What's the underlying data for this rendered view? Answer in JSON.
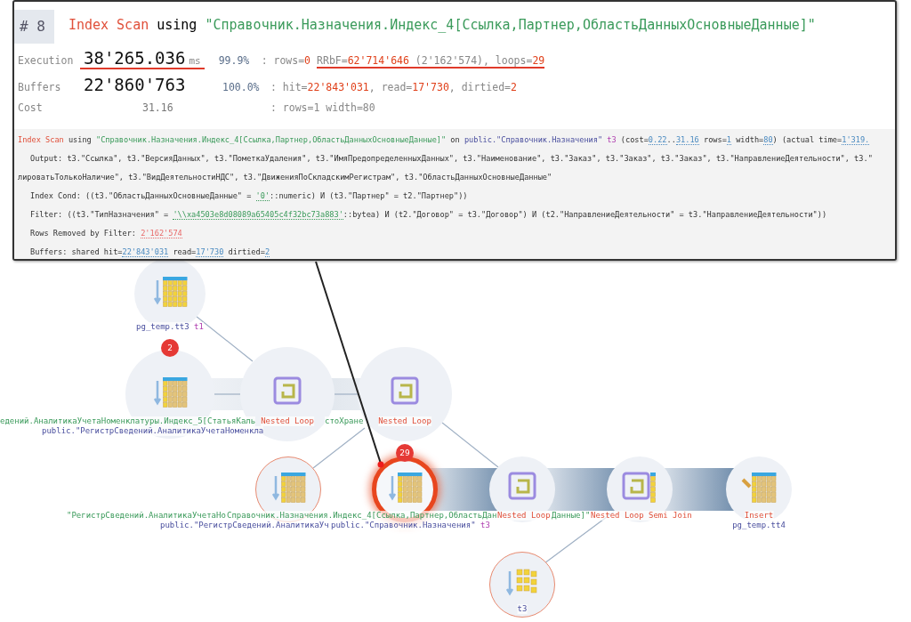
{
  "popup": {
    "node_number": "# 8",
    "title": [
      {
        "kind": "op",
        "text": "Index Scan"
      },
      {
        "kind": "plain",
        "text": " using "
      },
      {
        "kind": "name",
        "text": "\"Справочник.Назначения.Индекс_4[Ссылка,Партнер,ОбластьДанныхОсновныеДанные]\""
      }
    ],
    "metrics": [
      {
        "label": "Execution",
        "value": "38'265.036",
        "unit": "ms",
        "percent": "99.9%",
        "underlined": true,
        "details": [
          {
            "underlined": false,
            "segments": [
              {
                "kind": "plain",
                "text": ": rows="
              },
              {
                "kind": "count",
                "text": "0"
              }
            ]
          },
          {
            "underlined": true,
            "segments": [
              {
                "kind": "plain",
                "text": "RRbF="
              },
              {
                "kind": "count",
                "text": "62'714'646"
              },
              {
                "kind": "plain",
                "text": " (2'162'574), loops="
              },
              {
                "kind": "count",
                "text": "29"
              }
            ]
          }
        ]
      },
      {
        "label": "Buffers",
        "value": "22'860'763",
        "percent": "100.0%",
        "underlined": false,
        "details": [
          {
            "underlined": false,
            "segments": [
              {
                "kind": "plain",
                "text": ": hit="
              },
              {
                "kind": "count",
                "text": "22'843'031"
              },
              {
                "kind": "plain",
                "text": ", read="
              },
              {
                "kind": "count",
                "text": "17'730"
              },
              {
                "kind": "plain",
                "text": ", dirtied="
              },
              {
                "kind": "count",
                "text": "2"
              }
            ]
          }
        ]
      },
      {
        "label": "Cost",
        "value": "31.16",
        "underlined": false,
        "details": [
          {
            "underlined": false,
            "segments": [
              {
                "kind": "plain",
                "text": ": rows=1 width=80"
              }
            ]
          }
        ]
      }
    ],
    "detail_lines": [
      {
        "indent": false,
        "segments": [
          {
            "kind": "op",
            "text": "Index Scan"
          },
          {
            "kind": "plain",
            "text": " using "
          },
          {
            "kind": "name",
            "text": "\"Справочник.Назначения.Индекс_4[Ссылка,Партнер,ОбластьДанныхОсновныеДанные]\""
          },
          {
            "kind": "plain",
            "text": " on "
          },
          {
            "kind": "relation",
            "text": "public.\"Справочник.Назначения\""
          },
          {
            "kind": "alias",
            "text": "t3"
          },
          {
            "kind": "plain",
            "text": "  (cost="
          },
          {
            "kind": "number",
            "text": "0.22"
          },
          {
            "kind": "plain",
            "text": ".."
          },
          {
            "kind": "number",
            "text": "31.16"
          },
          {
            "kind": "plain",
            "text": " rows="
          },
          {
            "kind": "number",
            "text": "1"
          },
          {
            "kind": "plain",
            "text": " width="
          },
          {
            "kind": "number",
            "text": "80"
          },
          {
            "kind": "plain",
            "text": ") (actual time="
          },
          {
            "kind": "number",
            "text": "1'319."
          }
        ]
      },
      {
        "indent": true,
        "segments": [
          {
            "kind": "plain",
            "text": "Output: t3.\"Ссылка\", t3.\"ВерсияДанных\", t3.\"ПометкаУдаления\", t3.\"ИмяПредопределенныхДанных\", t3.\"Наименование\", t3.\"Заказ\", t3.\"Заказ\", t3.\"Заказ\", t3.\"НаправлениеДеятельности\", t3.\""
          }
        ]
      },
      {
        "indent": false,
        "segments": [
          {
            "kind": "plain",
            "text": "лироватьТолькоНаличие\", t3.\"ВидДеятельностиНДС\", t3.\"ДвиженияПоСкладскимРегистрам\", t3.\"ОбластьДанныхОсновныеДанные\""
          }
        ]
      },
      {
        "indent": true,
        "segments": [
          {
            "kind": "plain",
            "text": "Index Cond: ((t3.\"ОбластьДанныхОсновныеДанные\" = "
          },
          {
            "kind": "literal",
            "text": "'0'"
          },
          {
            "kind": "plain",
            "text": "::numeric) И (t3.\"Партнер\" = t2.\"Партнер\"))"
          }
        ]
      },
      {
        "indent": true,
        "segments": [
          {
            "kind": "plain",
            "text": "Filter: ((t3.\"ТипНазначения\" = "
          },
          {
            "kind": "literal",
            "text": "'\\\\xa4503e8d08089a65405c4f32bc73a883'"
          },
          {
            "kind": "plain",
            "text": "::bytea) И (t2.\"Договор\" = t3.\"Договор\") И (t2.\"НаправлениеДеятельности\" = t3.\"НаправлениеДеятельности\"))"
          }
        ]
      },
      {
        "indent": true,
        "segments": [
          {
            "kind": "plain",
            "text": "Rows Removed by Filter: "
          },
          {
            "kind": "bad_number",
            "text": "2'162'574"
          }
        ]
      },
      {
        "indent": true,
        "segments": [
          {
            "kind": "plain",
            "text": "Buffers: shared hit="
          },
          {
            "kind": "number",
            "text": "22'843'031"
          },
          {
            "kind": "plain",
            "text": " read="
          },
          {
            "kind": "number",
            "text": "17'730"
          },
          {
            "kind": "plain",
            "text": " dirtied="
          },
          {
            "kind": "number",
            "text": "2"
          }
        ]
      }
    ]
  },
  "plan": {
    "nodes": [
      {
        "kind": "table_scan",
        "selected": false,
        "warning": false,
        "labels": [
          [
            {
              "kind": "relation",
              "text": "pg_temp.tt3"
            },
            {
              "kind": "alias",
              "text": "t1"
            }
          ]
        ]
      },
      {
        "kind": "index_scan",
        "selected": false,
        "warning": false,
        "badge": "2",
        "labels": [
          [
            {
              "kind": "name",
              "text": "едений.АналитикаУчетаНоменклатуры.Индекс_5[СтатьяКаль"
            }
          ],
          [
            {
              "kind": "relation",
              "text": "public.\"РегистрСведений.АналитикаУчетаНоменкла"
            }
          ]
        ]
      },
      {
        "kind": "nested_loop",
        "selected": false,
        "warning": false,
        "labels": [
          [
            {
              "kind": "op",
              "text": "Nested Loop"
            }
          ]
        ]
      },
      {
        "kind": "nested_loop",
        "selected": false,
        "warning": false,
        "labels": [
          [
            {
              "kind": "op",
              "text": "Nested Loop"
            }
          ]
        ]
      },
      {
        "kind": "index_scan",
        "selected": false,
        "warning": true,
        "labels": [
          [
            {
              "kind": "name",
              "text": "\"РегистрСведений.АналитикаУчетаНо"
            }
          ],
          [
            {
              "kind": "relation",
              "text": "public.\"РегистрСведений.АналитикаУч"
            }
          ]
        ]
      },
      {
        "kind": "index_scan",
        "selected": true,
        "warning": false,
        "badge": "29",
        "labels": [
          [
            {
              "kind": "name",
              "text": "Справочник.Назначения.Индекс_4[Ссылка,Партнер,ОбластьДан"
            }
          ],
          [
            {
              "kind": "relation",
              "text": "public.\"Справочник.Назначения\""
            },
            {
              "kind": "alias",
              "text": "t3"
            }
          ]
        ]
      },
      {
        "kind": "nested_loop",
        "selected": false,
        "warning": false,
        "labels": [
          [
            {
              "kind": "op",
              "text": "Nested Loop"
            }
          ]
        ]
      },
      {
        "kind": "semi_join",
        "selected": false,
        "warning": false,
        "labels": [
          [
            {
              "kind": "op",
              "text": "Nested Loop Semi Join"
            }
          ]
        ]
      },
      {
        "kind": "insert",
        "selected": false,
        "warning": false,
        "labels": [
          [
            {
              "kind": "op",
              "text": "Insert"
            }
          ],
          [
            {
              "kind": "relation",
              "text": "pg_temp.tt4"
            }
          ]
        ]
      },
      {
        "kind": "index_only_scan",
        "selected": false,
        "warning": true,
        "labels": [
          [
            {
              "kind": "relation",
              "text": "t3"
            }
          ]
        ]
      }
    ],
    "label_fragments": [
      {
        "kind": "name",
        "text": "стоХране"
      },
      {
        "kind": "name",
        "text": "Данные]\""
      }
    ]
  }
}
